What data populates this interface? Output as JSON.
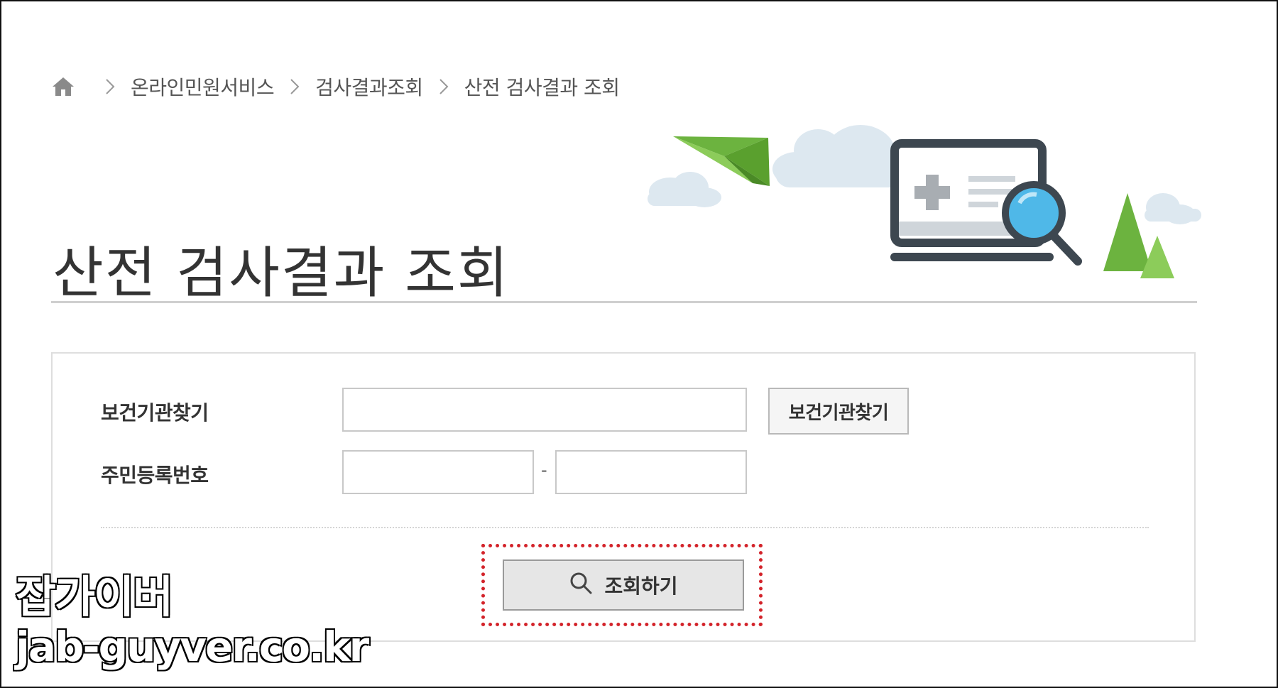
{
  "breadcrumb": {
    "items": [
      "온라인민원서비스",
      "검사결과조회",
      "산전 검사결과 조회"
    ]
  },
  "page": {
    "title": "산전 검사결과 조회"
  },
  "form": {
    "institution_label": "보건기관찾기",
    "institution_value": "",
    "find_button_label": "보건기관찾기",
    "rrn_label": "주민등록번호",
    "rrn_first_value": "",
    "rrn_separator": "-",
    "rrn_second_value": "",
    "search_button_label": "조회하기"
  },
  "watermark": {
    "line1": "잡가이버",
    "line2": "jab-guyver.co.kr"
  },
  "colors": {
    "highlight": "#d3232a",
    "accent_green": "#6cb33f",
    "accent_blue": "#4fb8e8"
  },
  "icons": {
    "home": "home-icon",
    "separator": "chevron-right-icon",
    "search": "search-icon"
  }
}
